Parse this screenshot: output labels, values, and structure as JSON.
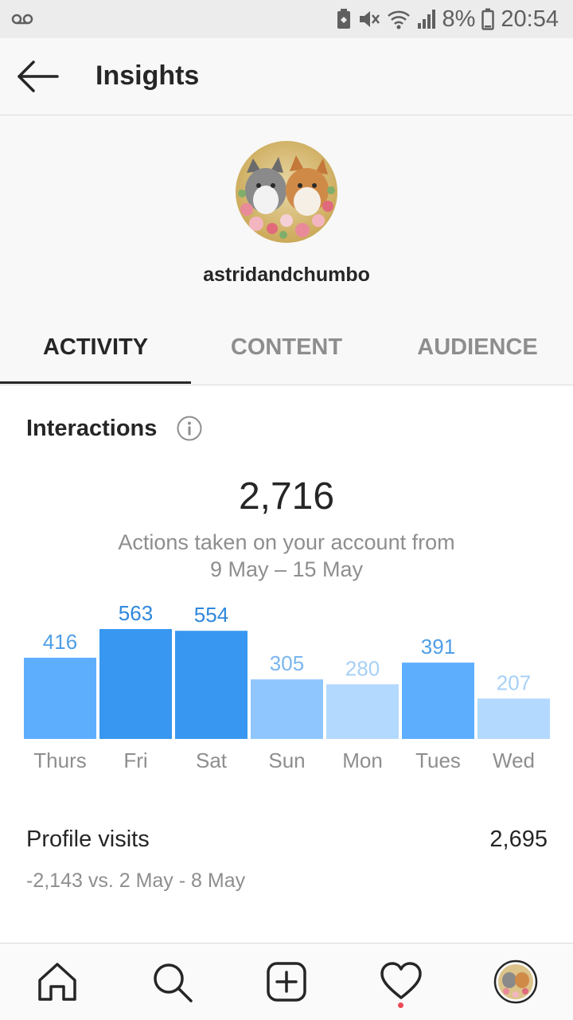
{
  "status_bar": {
    "battery": "8%",
    "time": "20:54",
    "icons": [
      "voicemail-icon",
      "battery-saver-icon",
      "mute-icon",
      "wifi-icon",
      "signal-icon",
      "battery-icon"
    ]
  },
  "header": {
    "title": "Insights",
    "back_icon": "arrow-left-icon"
  },
  "profile": {
    "username": "astridandchumbo"
  },
  "tabs": [
    {
      "label": "ACTIVITY",
      "active": true
    },
    {
      "label": "CONTENT",
      "active": false
    },
    {
      "label": "AUDIENCE",
      "active": false
    }
  ],
  "interactions": {
    "title": "Interactions",
    "total": "2,716",
    "subtitle_line1": "Actions taken on your account from",
    "subtitle_line2": "9 May – 15 May"
  },
  "chart_data": {
    "type": "bar",
    "categories": [
      "Thurs",
      "Fri",
      "Sat",
      "Sun",
      "Mon",
      "Tues",
      "Wed"
    ],
    "values": [
      416,
      563,
      554,
      305,
      280,
      391,
      207
    ],
    "ylim": [
      0,
      563
    ],
    "bar_colors": [
      "#5eaefe",
      "#3897f0",
      "#3897f0",
      "#8fc6fd",
      "#b3d9fe",
      "#5eaefe",
      "#b3d9fe"
    ],
    "label_colors": [
      "#4f9fe6",
      "#2f88dc",
      "#2f88dc",
      "#7ab6ef",
      "#a7d0f6",
      "#4f9fe6",
      "#a7d0f6"
    ]
  },
  "profile_visits": {
    "label": "Profile visits",
    "value": "2,695",
    "comparison": "-2,143 vs. 2 May - 8 May"
  },
  "bottom_nav": {
    "items": [
      "home-icon",
      "search-icon",
      "new-post-icon",
      "activity-heart-icon",
      "profile-avatar"
    ],
    "notification_color": "#ed4956"
  },
  "colors": {
    "accent": "#3897f0",
    "text": "#262626",
    "secondary_text": "#8e8e8e",
    "separator": "#dbdbdb"
  }
}
